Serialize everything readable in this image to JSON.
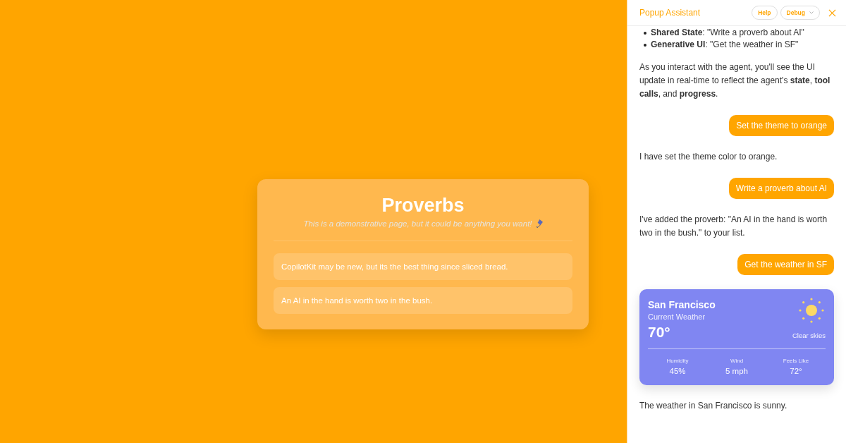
{
  "page": {
    "title": "Proverbs",
    "subtitle": "This is a demonstrative page, but it could be anything you want!",
    "proverbs": [
      "CopilotKit may be new, but its the best thing since sliced bread.",
      "An AI in the hand is worth two in the bush."
    ]
  },
  "assistant": {
    "title": "Popup Assistant",
    "buttons": [
      {
        "label": "Help",
        "kind": "plain"
      },
      {
        "label": "Debug",
        "kind": "dropdown"
      }
    ],
    "messages": [
      {
        "kind": "list",
        "items": [
          "**Shared State**: \"Write a proverb about AI\"",
          "**Generative UI**: \"Get the weather in SF\""
        ]
      },
      {
        "kind": "assistant",
        "text": "As you interact with the agent, you'll see the UI update in real-time to reflect the agent's **state**, **tool calls**, and **progress**."
      },
      {
        "kind": "user",
        "text": "Set the theme to orange"
      },
      {
        "kind": "assistant",
        "text": "I have set the theme color to orange."
      },
      {
        "kind": "user",
        "text": "Write a proverb about AI"
      },
      {
        "kind": "assistant",
        "text": "I've added the proverb: \"An AI in the hand is worth two in the bush.\" to your list."
      },
      {
        "kind": "user",
        "text": "Get the weather in SF"
      },
      {
        "kind": "weather",
        "city": "San Francisco",
        "subtitle": "Current Weather",
        "temperature": "70°",
        "conditions": "Clear skies",
        "stats": [
          {
            "label": "Humidity",
            "value": "45%"
          },
          {
            "label": "Wind",
            "value": "5 mph"
          },
          {
            "label": "Feels Like",
            "value": "72°"
          }
        ]
      },
      {
        "kind": "assistant",
        "text": "The weather in San Francisco is sunny."
      }
    ]
  }
}
